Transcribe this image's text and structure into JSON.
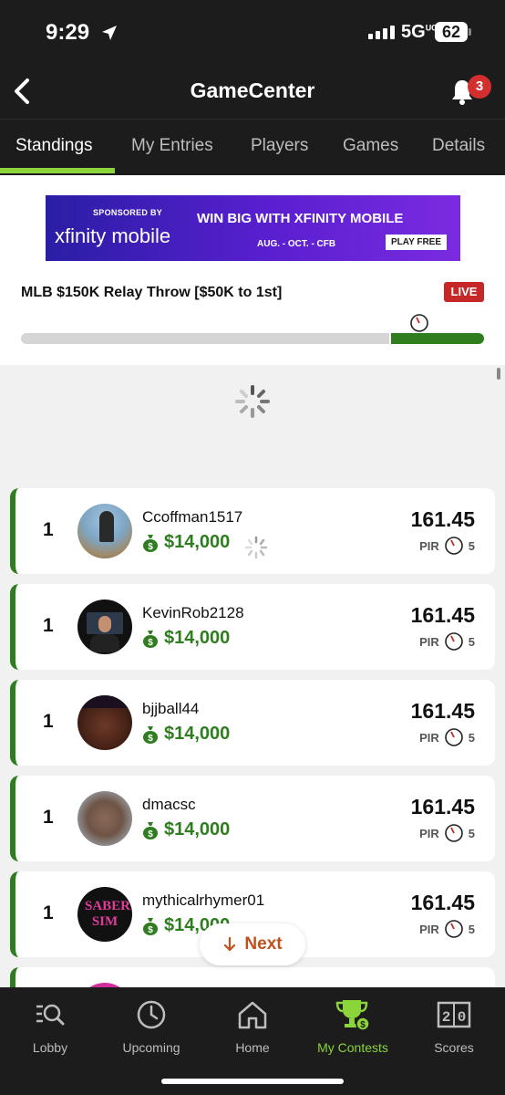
{
  "status_bar": {
    "time": "9:29",
    "network": "5G",
    "network_sup": "UC",
    "battery": "62"
  },
  "header": {
    "title": "GameCenter",
    "notification_count": "3"
  },
  "tabs": [
    {
      "label": "Standings",
      "active": true
    },
    {
      "label": "My Entries"
    },
    {
      "label": "Players"
    },
    {
      "label": "Games"
    },
    {
      "label": "Details"
    }
  ],
  "banner": {
    "sponsor": "SPONSORED BY",
    "brand": "xfinity mobile",
    "headline": "WIN BIG WITH XFINITY MOBILE",
    "dates": "AUG. - OCT. - CFB",
    "cta": "PLAY FREE"
  },
  "contest": {
    "title": "MLB $150K Relay Throw [$50K to 1st]",
    "status": "LIVE",
    "progress": 0.8
  },
  "standings": [
    {
      "rank": "1",
      "username": "Ccoffman1517",
      "prize": "$14,000",
      "score": "161.45",
      "pir_label": "PIR",
      "pir": "5"
    },
    {
      "rank": "1",
      "username": "KevinRob2128",
      "prize": "$14,000",
      "score": "161.45",
      "pir_label": "PIR",
      "pir": "5"
    },
    {
      "rank": "1",
      "username": "bjjball44",
      "prize": "$14,000",
      "score": "161.45",
      "pir_label": "PIR",
      "pir": "5"
    },
    {
      "rank": "1",
      "username": "dmacsc",
      "prize": "$14,000",
      "score": "161.45",
      "pir_label": "PIR",
      "pir": "5"
    },
    {
      "rank": "1",
      "username": "mythicalrhymer01",
      "prize": "$14,000",
      "score": "161.45",
      "pir_label": "PIR",
      "pir": "5",
      "avatar_text": "SABER SIM"
    }
  ],
  "next_button": {
    "label": "Next"
  },
  "bottom_nav": [
    {
      "label": "Lobby",
      "icon": "lobby-search-icon"
    },
    {
      "label": "Upcoming",
      "icon": "clock-icon"
    },
    {
      "label": "Home",
      "icon": "home-icon"
    },
    {
      "label": "My Contests",
      "icon": "trophy-icon",
      "active": true
    },
    {
      "label": "Scores",
      "icon": "scoreboard-icon"
    }
  ],
  "colors": {
    "accent_green": "#8bd43a",
    "money_green": "#2e7d1e",
    "live_red": "#c62828",
    "next_orange": "#c0501c"
  }
}
